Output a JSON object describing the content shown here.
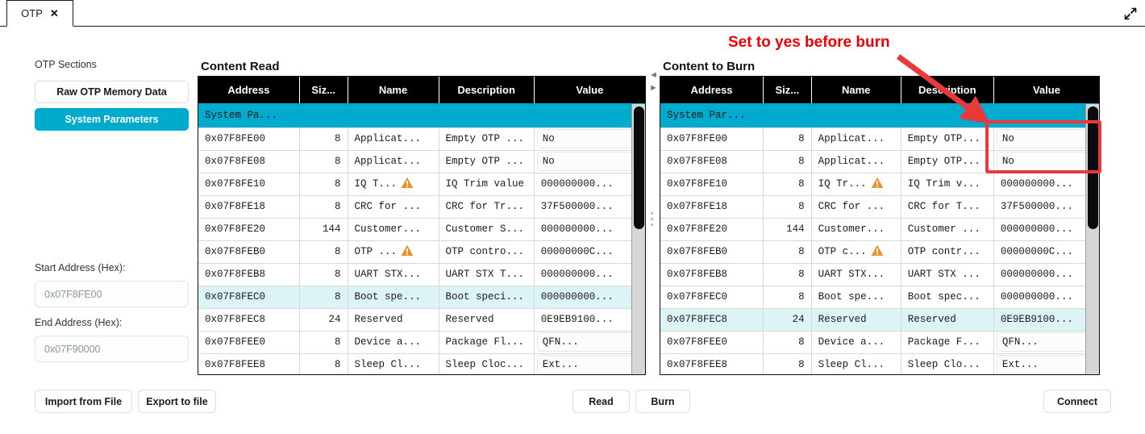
{
  "window": {
    "tab_label": "OTP",
    "close_icon": "close-icon",
    "expand_icon": "expand-diagonal-icon"
  },
  "sidebar": {
    "section_title": "OTP Sections",
    "buttons": [
      {
        "label": "Raw OTP Memory Data",
        "active": false
      },
      {
        "label": "System Parameters",
        "active": true
      }
    ],
    "start_address_label": "Start Address (Hex):",
    "start_address_value": "0x07F8FE00",
    "end_address_label": "End Address (Hex):",
    "end_address_value": "0x07F90000",
    "import_label": "Import from File",
    "export_label": "Export to file"
  },
  "actions": {
    "read_label": "Read",
    "burn_label": "Burn",
    "connect_label": "Connect"
  },
  "colors": {
    "accent": "#00ABCE",
    "header_bg": "#000000",
    "selected_row": "#DDF4F7",
    "annotation_red": "#EE0000",
    "warning_orange": "#E8912E"
  },
  "panels": {
    "read": {
      "title": "Content Read",
      "columns": [
        "Address",
        "Siz...",
        "Name",
        "Description",
        "Value"
      ],
      "group_row": "System Pa...",
      "rows": [
        {
          "address": "0x07F8FE00",
          "size": "8",
          "name": "Applicat...",
          "warn": false,
          "description": "Empty OTP ...",
          "value": "No",
          "dropdown": true,
          "selected": false
        },
        {
          "address": "0x07F8FE08",
          "size": "8",
          "name": "Applicat...",
          "warn": false,
          "description": "Empty OTP ...",
          "value": "No",
          "dropdown": true,
          "selected": false
        },
        {
          "address": "0x07F8FE10",
          "size": "8",
          "name": "IQ T...",
          "warn": true,
          "description": "IQ Trim value",
          "value": "000000000...",
          "dropdown": false,
          "selected": false
        },
        {
          "address": "0x07F8FE18",
          "size": "8",
          "name": "CRC for ...",
          "warn": false,
          "description": "CRC for Tr...",
          "value": "37F500000...",
          "dropdown": false,
          "selected": false
        },
        {
          "address": "0x07F8FE20",
          "size": "144",
          "name": "Customer...",
          "warn": false,
          "description": "Customer S...",
          "value": "000000000...",
          "dropdown": false,
          "selected": false
        },
        {
          "address": "0x07F8FEB0",
          "size": "8",
          "name": "OTP ...",
          "warn": true,
          "description": "OTP contro...",
          "value": "00000000C...",
          "dropdown": false,
          "selected": false
        },
        {
          "address": "0x07F8FEB8",
          "size": "8",
          "name": "UART STX...",
          "warn": false,
          "description": "UART STX T...",
          "value": "000000000...",
          "dropdown": false,
          "selected": false
        },
        {
          "address": "0x07F8FEC0",
          "size": "8",
          "name": "Boot spe...",
          "warn": false,
          "description": "Boot speci...",
          "value": "000000000...",
          "dropdown": false,
          "selected": true
        },
        {
          "address": "0x07F8FEC8",
          "size": "24",
          "name": "Reserved",
          "warn": false,
          "description": "Reserved",
          "value": "0E9EB9100...",
          "dropdown": false,
          "selected": false
        },
        {
          "address": "0x07F8FEE0",
          "size": "8",
          "name": "Device a...",
          "warn": false,
          "description": "Package Fl...",
          "value": "QFN...",
          "dropdown": true,
          "selected": false
        },
        {
          "address": "0x07F8FEE8",
          "size": "8",
          "name": "Sleep Cl...",
          "warn": false,
          "description": "Sleep Cloc...",
          "value": "Ext...",
          "dropdown": true,
          "selected": false
        }
      ]
    },
    "burn": {
      "title": "Content to Burn",
      "columns": [
        "Address",
        "Siz...",
        "Name",
        "Description",
        "Value"
      ],
      "group_row": "System Par...",
      "rows": [
        {
          "address": "0x07F8FE00",
          "size": "8",
          "name": "Applicat...",
          "warn": false,
          "description": "Empty OTP...",
          "value": "No",
          "dropdown": true,
          "selected": false
        },
        {
          "address": "0x07F8FE08",
          "size": "8",
          "name": "Applicat...",
          "warn": false,
          "description": "Empty OTP...",
          "value": "No",
          "dropdown": true,
          "selected": false
        },
        {
          "address": "0x07F8FE10",
          "size": "8",
          "name": "IQ Tr...",
          "warn": true,
          "description": "IQ Trim v...",
          "value": "000000000...",
          "dropdown": false,
          "selected": false
        },
        {
          "address": "0x07F8FE18",
          "size": "8",
          "name": "CRC for ...",
          "warn": false,
          "description": "CRC for T...",
          "value": "37F500000...",
          "dropdown": false,
          "selected": false
        },
        {
          "address": "0x07F8FE20",
          "size": "144",
          "name": "Customer...",
          "warn": false,
          "description": "Customer ...",
          "value": "000000000...",
          "dropdown": false,
          "selected": false
        },
        {
          "address": "0x07F8FEB0",
          "size": "8",
          "name": "OTP c...",
          "warn": true,
          "description": "OTP contr...",
          "value": "00000000C...",
          "dropdown": false,
          "selected": false
        },
        {
          "address": "0x07F8FEB8",
          "size": "8",
          "name": "UART STX...",
          "warn": false,
          "description": "UART STX ...",
          "value": "000000000...",
          "dropdown": false,
          "selected": false
        },
        {
          "address": "0x07F8FEC0",
          "size": "8",
          "name": "Boot spe...",
          "warn": false,
          "description": "Boot spec...",
          "value": "000000000...",
          "dropdown": false,
          "selected": false
        },
        {
          "address": "0x07F8FEC8",
          "size": "24",
          "name": "Reserved",
          "warn": false,
          "description": "Reserved",
          "value": "0E9EB9100...",
          "dropdown": false,
          "selected": true
        },
        {
          "address": "0x07F8FEE0",
          "size": "8",
          "name": "Device a...",
          "warn": false,
          "description": "Package F...",
          "value": "QFN...",
          "dropdown": true,
          "selected": false
        },
        {
          "address": "0x07F8FEE8",
          "size": "8",
          "name": "Sleep Cl...",
          "warn": false,
          "description": "Sleep Clo...",
          "value": "Ext...",
          "dropdown": true,
          "selected": false
        }
      ]
    }
  },
  "annotation": {
    "text": "Set to yes before burn",
    "arrow_icon": "arrow-pointer-icon",
    "highlight_icon": "highlight-rectangle"
  }
}
